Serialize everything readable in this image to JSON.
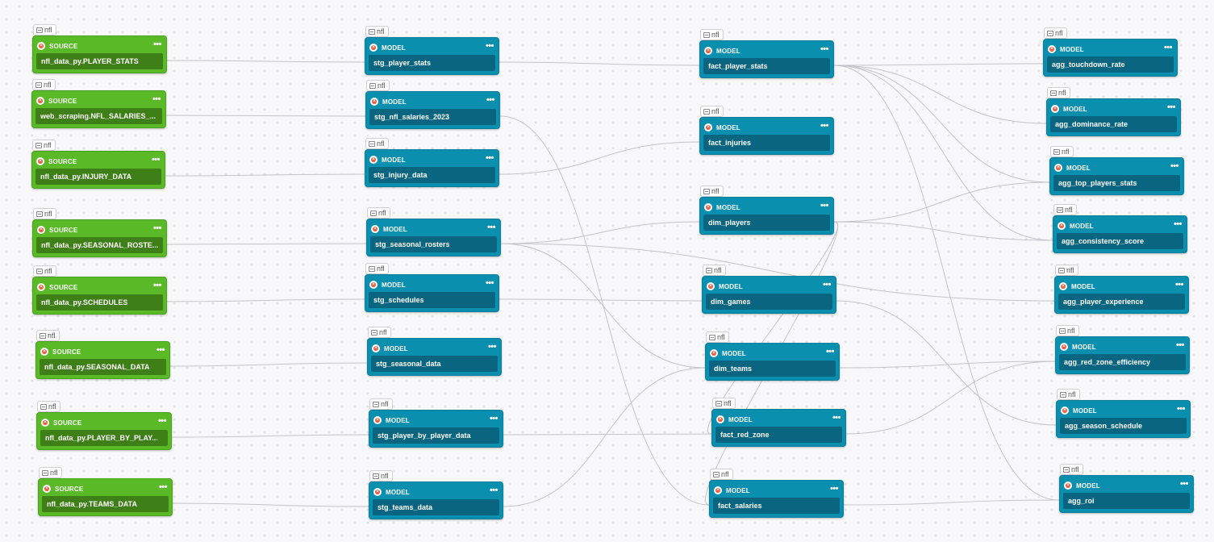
{
  "canvas": {
    "badge_label": "nfl",
    "more_label": "•••",
    "kind_glyph": "×",
    "colors": {
      "source_node": "#5ab927",
      "source_label": "#3f7f17",
      "model_node": "#0b8fae",
      "model_label": "#0a6680",
      "edge": "#c3c3c9",
      "kind_icon": "#e9583a"
    }
  },
  "sources": [
    {
      "kind": "SOURCE",
      "name": "nfl_data_py.PLAYER_STATS"
    },
    {
      "kind": "SOURCE",
      "name": "web_scraping.NFL_SALARIES_..."
    },
    {
      "kind": "SOURCE",
      "name": "nfl_data_py.INJURY_DATA"
    },
    {
      "kind": "SOURCE",
      "name": "nfl_data_py.SEASONAL_ROSTE..."
    },
    {
      "kind": "SOURCE",
      "name": "nfl_data_py.SCHEDULES"
    },
    {
      "kind": "SOURCE",
      "name": "nfl_data_py.SEASONAL_DATA"
    },
    {
      "kind": "SOURCE",
      "name": "nfl_data_py.PLAYER_BY_PLAY..."
    },
    {
      "kind": "SOURCE",
      "name": "nfl_data_py.TEAMS_DATA"
    }
  ],
  "staging": [
    {
      "kind": "MODEL",
      "name": "stg_player_stats"
    },
    {
      "kind": "MODEL",
      "name": "stg_nfl_salaries_2023"
    },
    {
      "kind": "MODEL",
      "name": "stg_injury_data"
    },
    {
      "kind": "MODEL",
      "name": "stg_seasonal_rosters"
    },
    {
      "kind": "MODEL",
      "name": "stg_schedules"
    },
    {
      "kind": "MODEL",
      "name": "stg_seasonal_data"
    },
    {
      "kind": "MODEL",
      "name": "stg_player_by_player_data"
    },
    {
      "kind": "MODEL",
      "name": "stg_teams_data"
    }
  ],
  "core": [
    {
      "kind": "MODEL",
      "name": "fact_player_stats"
    },
    {
      "kind": "MODEL",
      "name": "fact_injuries"
    },
    {
      "kind": "MODEL",
      "name": "dim_players"
    },
    {
      "kind": "MODEL",
      "name": "dim_games"
    },
    {
      "kind": "MODEL",
      "name": "dim_teams"
    },
    {
      "kind": "MODEL",
      "name": "fact_red_zone"
    },
    {
      "kind": "MODEL",
      "name": "fact_salaries"
    }
  ],
  "aggregates": [
    {
      "kind": "MODEL",
      "name": "agg_touchdown_rate"
    },
    {
      "kind": "MODEL",
      "name": "agg_dominance_rate"
    },
    {
      "kind": "MODEL",
      "name": "agg_top_players_stats"
    },
    {
      "kind": "MODEL",
      "name": "agg_consistency_score"
    },
    {
      "kind": "MODEL",
      "name": "agg_player_experience"
    },
    {
      "kind": "MODEL",
      "name": "agg_red_zone_efficiency"
    },
    {
      "kind": "MODEL",
      "name": "agg_season_schedule"
    },
    {
      "kind": "MODEL",
      "name": "agg_roi"
    }
  ]
}
